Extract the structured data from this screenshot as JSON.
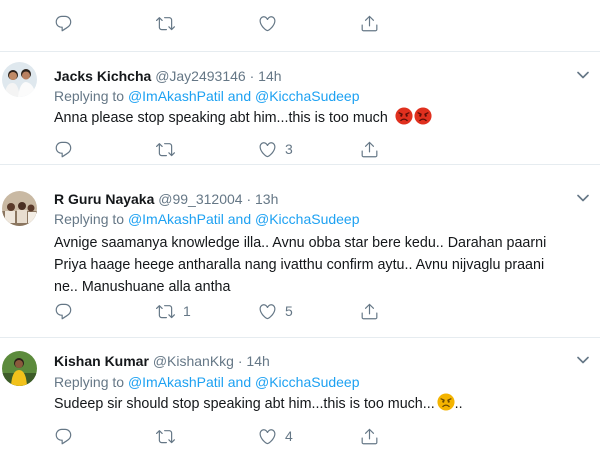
{
  "top_actions": {
    "reply_count": "",
    "retweet_count": "",
    "like_count": ""
  },
  "tweets": [
    {
      "name": "Jacks Kichcha",
      "handle": "@Jay2493146",
      "separator": "·",
      "time": "14h",
      "replying_prefix": "Replying to",
      "replying_to_1": "@ImAkashPatil",
      "replying_and": "and",
      "replying_to_2": "@KicchaSudeep",
      "text": "Anna please  stop speaking abt him...this is too much",
      "emoji": "pouting-face ×2",
      "reply_count": "",
      "retweet_count": "",
      "like_count": "3"
    },
    {
      "name": "R Guru Nayaka",
      "handle": "@99_312004",
      "separator": "·",
      "time": "13h",
      "replying_prefix": "Replying to",
      "replying_to_1": "@ImAkashPatil",
      "replying_and": "and",
      "replying_to_2": "@KicchaSudeep",
      "text_line1": "Avnige saamanya knowledge illa.. Avnu obba star bere kedu.. Darahan paarni",
      "text_line2": "Priya haage heege antharalla nang ivatthu confirm aytu.. Avnu nijvaglu praani",
      "text_line3": "ne.. Manushuane alla antha",
      "reply_count": "",
      "retweet_count": "1",
      "like_count": "5"
    },
    {
      "name": "Kishan Kumar",
      "handle": "@KishanKkg",
      "separator": "·",
      "time": "14h",
      "replying_prefix": "Replying to",
      "replying_to_1": "@ImAkashPatil",
      "replying_and": "and",
      "replying_to_2": "@KicchaSudeep",
      "text": "Sudeep sir should stop speaking abt him...this is too much...",
      "text_suffix": "..",
      "emoji": "angry-face",
      "reply_count": "",
      "retweet_count": "",
      "like_count": "4"
    }
  ],
  "colors": {
    "link": "#1da1f2",
    "secondary_text": "#657786",
    "primary_text": "#14171a",
    "divider": "#e6ecf0",
    "emoji_red": "#e0301e",
    "emoji_yellow": "#f4b400"
  },
  "icons": [
    "reply-icon",
    "retweet-icon",
    "like-icon",
    "share-icon",
    "chevron-down-icon"
  ]
}
